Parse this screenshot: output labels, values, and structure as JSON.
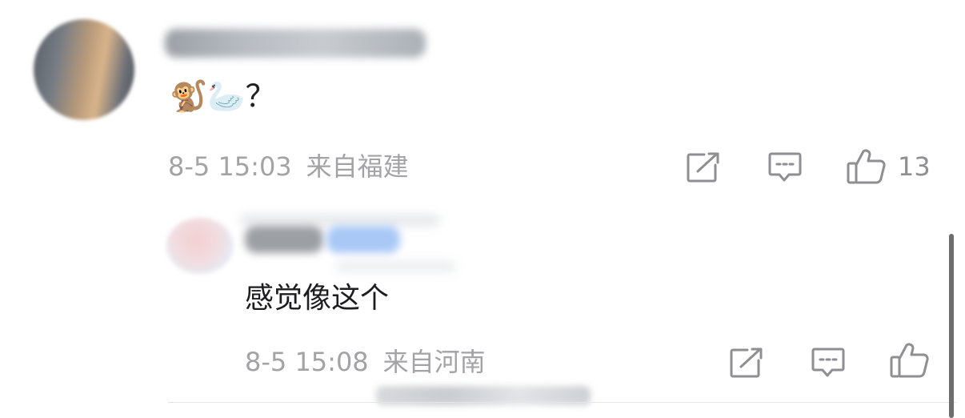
{
  "comment": {
    "content": "🐒🦢？",
    "time": "8-5 15:03",
    "location": "来自福建",
    "like_count": "13"
  },
  "reply": {
    "content": "感觉像这个",
    "time": "8-5 15:08",
    "location": "来自河南"
  },
  "icons": {
    "share": "share-icon",
    "comment": "comment-icon",
    "like": "thumbs-up-icon"
  }
}
